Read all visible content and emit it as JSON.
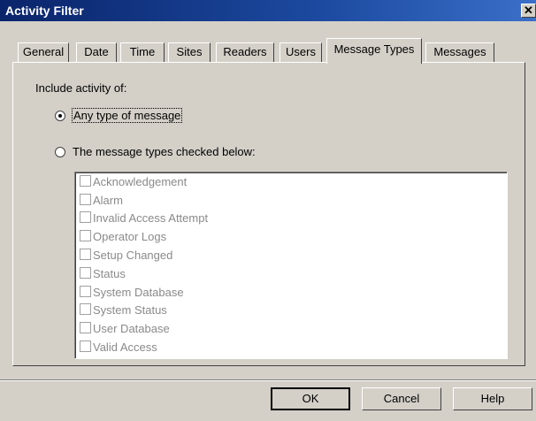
{
  "window": {
    "title": "Activity Filter",
    "close_glyph": "✕"
  },
  "tabs": [
    {
      "label": "General"
    },
    {
      "label": "Date"
    },
    {
      "label": "Time"
    },
    {
      "label": "Sites"
    },
    {
      "label": "Readers"
    },
    {
      "label": "Users"
    },
    {
      "label": "Message Types",
      "active": true
    },
    {
      "label": "Messages"
    }
  ],
  "filter": {
    "include_label": "Include activity of:",
    "option_any": "Any type of message",
    "option_checked": "The message types checked below:",
    "selected": "any"
  },
  "message_types": [
    {
      "label": "Acknowledgement",
      "checked": false
    },
    {
      "label": "Alarm",
      "checked": false
    },
    {
      "label": "Invalid Access Attempt",
      "checked": false
    },
    {
      "label": "Operator Logs",
      "checked": false
    },
    {
      "label": "Setup Changed",
      "checked": false
    },
    {
      "label": "Status",
      "checked": false
    },
    {
      "label": "System Database",
      "checked": false
    },
    {
      "label": "System Status",
      "checked": false
    },
    {
      "label": "User Database",
      "checked": false
    },
    {
      "label": "Valid Access",
      "checked": false
    }
  ],
  "buttons": {
    "ok": "OK",
    "cancel": "Cancel",
    "help": "Help"
  }
}
